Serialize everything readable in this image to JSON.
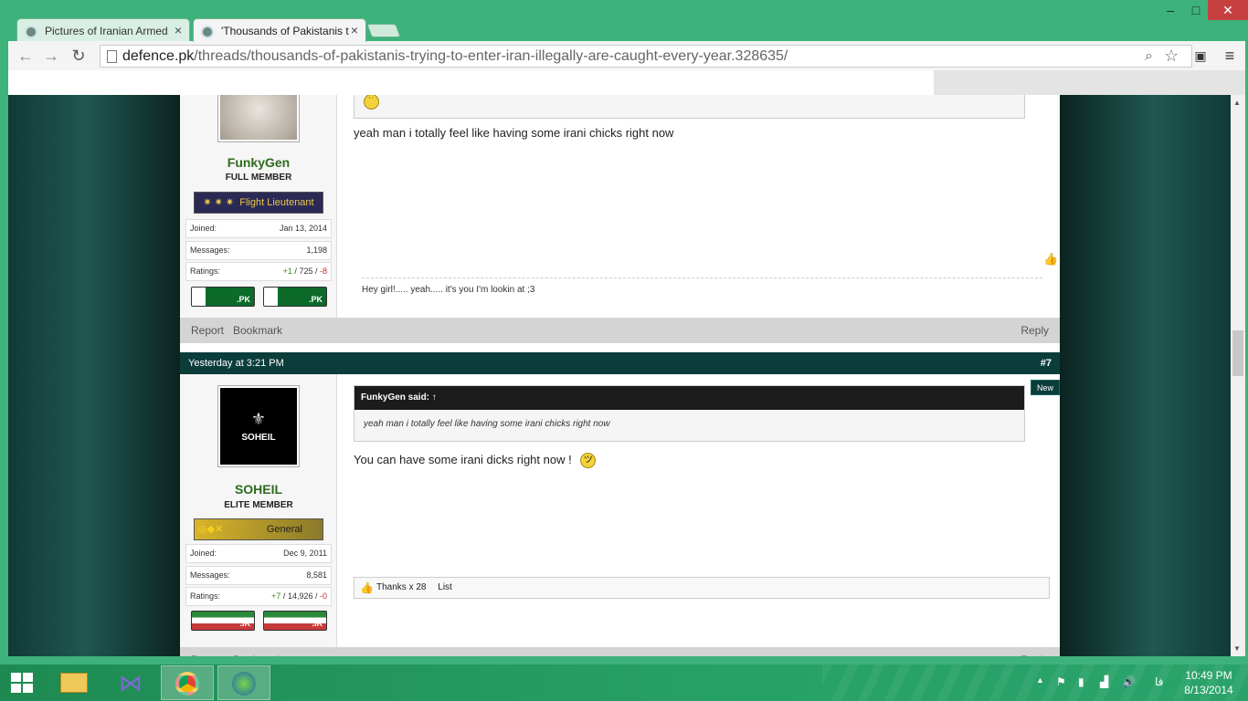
{
  "browser": {
    "tabs": [
      {
        "title": "Pictures of Iranian Armed",
        "close": "×"
      },
      {
        "title": "'Thousands of Pakistanis t",
        "close": "×"
      }
    ],
    "window_controls": {
      "minimize": "–",
      "maximize": "□",
      "close": "✕"
    },
    "url": {
      "domain": "defence.pk",
      "path": "/threads/thousands-of-pakistanis-trying-to-enter-iran-illegally-are-caught-every-year.328635/"
    }
  },
  "posts": [
    {
      "user": {
        "name": "FunkyGen",
        "title": "FULL MEMBER",
        "rank": "Flight Lieutenant",
        "rank_stars": "✷ ✷ ✷",
        "joined_label": "Joined:",
        "joined": "Jan 13, 2014",
        "messages_label": "Messages:",
        "messages": "1,198",
        "ratings_label": "Ratings:",
        "ratings_pos": "+1",
        "ratings_mid": "725",
        "ratings_neg": "-8",
        "flags": [
          ".PK",
          ".PK"
        ]
      },
      "message": "yeah man i totally feel like having some irani chicks right now",
      "signature": "Hey girl!..... yeah..... it's you I'm lookin at ;3",
      "footer": {
        "report": "Report",
        "bookmark": "Bookmark",
        "reply": "Reply"
      }
    },
    {
      "header": {
        "time": "Yesterday at 3:21 PM",
        "number": "#7",
        "new_badge": "New"
      },
      "user": {
        "name": "SOHEIL",
        "title": "ELITE MEMBER",
        "rank": "General",
        "avatar_text": "SOHEIL",
        "joined_label": "Joined:",
        "joined": "Dec 9, 2011",
        "messages_label": "Messages:",
        "messages": "8,581",
        "ratings_label": "Ratings:",
        "ratings_pos": "+7",
        "ratings_mid": "14,926",
        "ratings_neg": "-0",
        "flags": [
          ".IR",
          ".IR"
        ]
      },
      "quote": {
        "author": "FunkyGen said: ↑",
        "text": "yeah man i totally feel like having some irani chicks right now"
      },
      "message": "You can have some irani dicks right now !",
      "thanks": {
        "label": "Thanks x 28",
        "list": "List"
      },
      "footer": {
        "report": "Report",
        "bookmark": "Bookmark",
        "reply": "Reply"
      }
    }
  ],
  "taskbar": {
    "clock_time": "10:49 PM",
    "clock_date": "8/13/2014",
    "language": "فا"
  }
}
